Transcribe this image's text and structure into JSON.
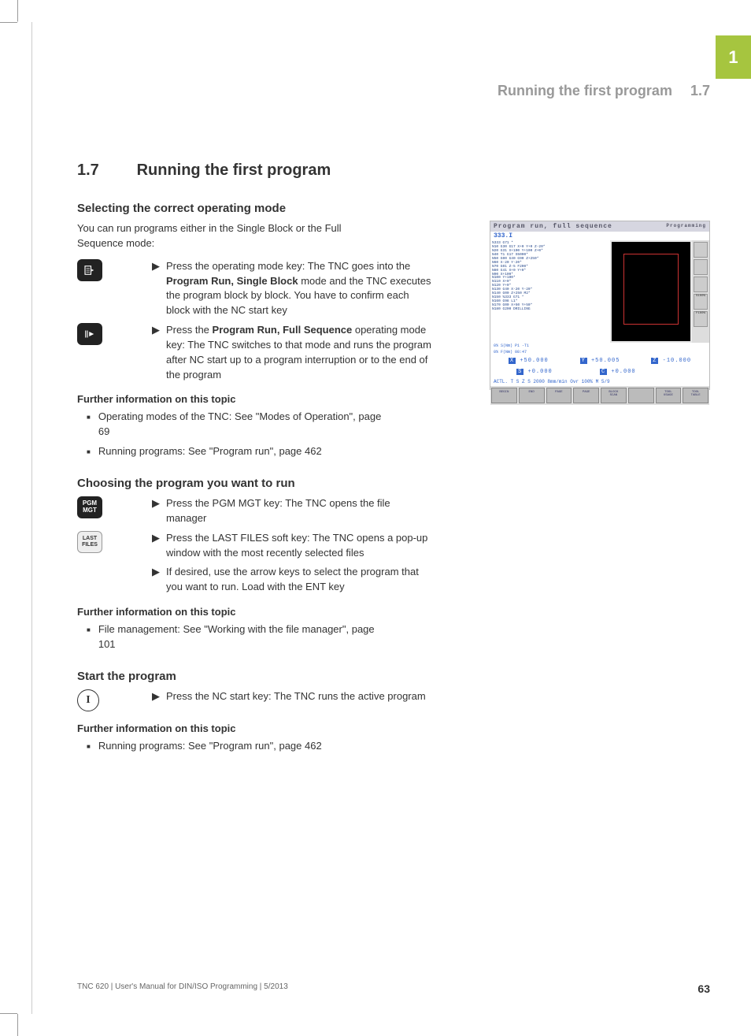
{
  "tab": {
    "chapter": "1"
  },
  "running_head": {
    "title": "Running the first program",
    "section": "1.7"
  },
  "heading": {
    "number": "1.7",
    "title": "Running the first program"
  },
  "sec1": {
    "title": "Selecting the correct operating mode",
    "intro": "You can run programs either in the Single Block or the Full Sequence mode:",
    "step1_a": "Press the operating mode key: The TNC goes into the ",
    "step1_b": "Program Run, Single Block",
    "step1_c": " mode and the TNC executes the program block by block. You have to confirm each block with the NC start key",
    "step2_a": "Press the ",
    "step2_b": "Program Run, Full Sequence",
    "step2_c": " operating mode key: The TNC switches to that mode and runs the program after NC start up to a program interruption or to the end of the program",
    "further_head": "Further information on this topic",
    "further1": "Operating modes of the TNC: See \"Modes of Operation\", page 69",
    "further2": "Running programs: See \"Program run\", page 462"
  },
  "sec2": {
    "title": "Choosing the program you want to run",
    "key1_label": "PGM\nMGT",
    "step1": "Press the PGM MGT key: The TNC opens the file manager",
    "key2_label": "LAST\nFILES",
    "step2": "Press the LAST FILES soft key: The TNC opens a pop-up window with the most recently selected files",
    "step3": "If desired, use the arrow keys to select the program that you want to run. Load with the ENT key",
    "further_head": "Further information on this topic",
    "further1": "File management: See \"Working with the file manager\", page 101"
  },
  "sec3": {
    "title": "Start the program",
    "key1_label": "I",
    "step1": "Press the NC start key: The TNC runs the active program",
    "further_head": "Further information on this topic",
    "further1": "Running programs: See \"Program run\", page 462"
  },
  "screenshot": {
    "title": "Program run, full sequence",
    "mode": "Programming",
    "filename": "333.I",
    "code_lines": "%333 G71 *\nN10 G30 G17 X+0 Y+0 Z-20*\nN20 G31 X+100 Y+100 Z+0*\nN40 T1 G17 S5000*\nN50 G00 G40 G90 Z+250*\nN60 X-20 Y-20*\nN70 G01 Z-5 F200*\nN80 G41 X+0 Y+0*\nN90 X+100*\nN100 Y+100*\nN110 X+0*\nN120 Y+0*\nN130 G40 X-20 Y-20*\nN140 G00 Z+250 M2*\nN150 %333 G71 *\nN160 G98 L1*\nN170 G00 X+50 Y+50*\nN180 G200 DRILLING",
    "info1": "0% S(Nm) P1 -T1",
    "info2": "0% F(Nm) 08:47",
    "coords": {
      "x_lbl": "X",
      "x": "+50.000",
      "y_lbl": "Y",
      "y": "+50.005",
      "z_lbl": "Z",
      "z": "-10.000",
      "s_lbl": "S",
      "s": "+0.000",
      "c_lbl": "C",
      "c": "+0.000"
    },
    "status": "ACTL.    T     S Z S 2000    8mm/min    Ovr 100% M 5/9",
    "side_labels": {
      "s100": "S100%",
      "f100": "F100%",
      "off": "OFF"
    },
    "softkeys": [
      "BEGIN",
      "END",
      "PAGE",
      "PAGE",
      "BLOCK\nSCAN",
      "",
      "TOOL\nUSAGE",
      "TOOL\nTABLE"
    ]
  },
  "footer": {
    "left": "TNC 620 | User's Manual for DIN/ISO Programming | 5/2013",
    "page": "63"
  }
}
